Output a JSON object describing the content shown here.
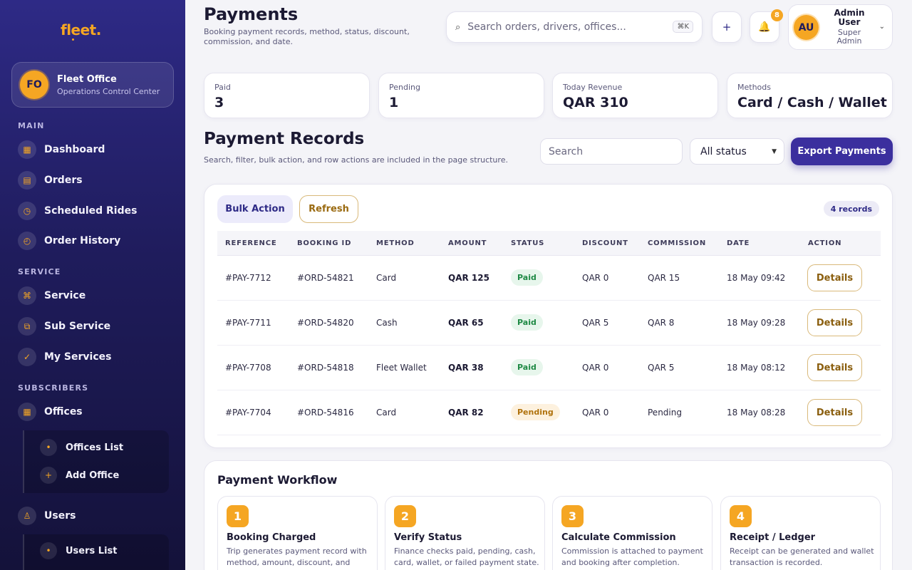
{
  "app": {
    "logo": "fleet."
  },
  "office": {
    "initials": "FO",
    "name": "Fleet Office",
    "subtitle": "Operations Control Center"
  },
  "sidebar": {
    "sections": [
      {
        "label": "MAIN"
      },
      {
        "label": "SERVICE"
      },
      {
        "label": "SUBSCRIBERS"
      }
    ],
    "items": [
      {
        "label": "Dashboard",
        "icon": "dashboard-icon",
        "glyph": "▦"
      },
      {
        "label": "Orders",
        "icon": "orders-icon",
        "glyph": "▤"
      },
      {
        "label": "Scheduled Rides",
        "icon": "clock-icon",
        "glyph": "◷"
      },
      {
        "label": "Order History",
        "icon": "history-icon",
        "glyph": "◴"
      },
      {
        "label": "Service",
        "icon": "command-icon",
        "glyph": "⌘"
      },
      {
        "label": "Sub Service",
        "icon": "copy-icon",
        "glyph": "⧉"
      },
      {
        "label": "My Services",
        "icon": "check-icon",
        "glyph": "✓"
      },
      {
        "label": "Offices",
        "icon": "offices-icon",
        "glyph": "▦"
      },
      {
        "label": "Users",
        "icon": "user-icon",
        "glyph": "♙"
      }
    ],
    "offices_sub": [
      {
        "label": "Offices List",
        "glyph": "•"
      },
      {
        "label": "Add Office",
        "glyph": "+"
      }
    ],
    "users_sub": [
      {
        "label": "Users List",
        "glyph": "•"
      }
    ]
  },
  "header": {
    "title": "Payments",
    "subtitle": "Booking payment records, method, status, discount, commission, and date.",
    "search_placeholder": "Search orders, drivers, offices...",
    "shortcut": "⌘K",
    "add_glyph": "+",
    "bell_glyph": "🔔",
    "notification_count": "8",
    "user": {
      "initials": "AU",
      "name": "Admin User",
      "role": "Super Admin"
    }
  },
  "stats": [
    {
      "label": "Paid",
      "value": "3"
    },
    {
      "label": "Pending",
      "value": "1"
    },
    {
      "label": "Today Revenue",
      "value": "QAR 310"
    },
    {
      "label": "Methods",
      "value": "Card / Cash / Wallet"
    }
  ],
  "records": {
    "title": "Payment Records",
    "subtitle": "Search, filter, bulk action, and row actions are included in the page structure.",
    "search_placeholder": "Search",
    "status_filter": "All status",
    "export_label": "Export Payments",
    "bulk_label": "Bulk Action",
    "refresh_label": "Refresh",
    "count_label": "4 records",
    "columns": [
      "REFERENCE",
      "BOOKING ID",
      "METHOD",
      "AMOUNT",
      "STATUS",
      "DISCOUNT",
      "COMMISSION",
      "DATE",
      "ACTION"
    ],
    "rows": [
      {
        "reference": "#PAY-7712",
        "booking": "#ORD-54821",
        "method": "Card",
        "amount": "QAR 125",
        "status": "Paid",
        "status_type": "paid",
        "discount": "QAR 0",
        "commission": "QAR 15",
        "date": "18 May 09:42",
        "action": "Details"
      },
      {
        "reference": "#PAY-7711",
        "booking": "#ORD-54820",
        "method": "Cash",
        "amount": "QAR 65",
        "status": "Paid",
        "status_type": "paid",
        "discount": "QAR 5",
        "commission": "QAR 8",
        "date": "18 May 09:28",
        "action": "Details"
      },
      {
        "reference": "#PAY-7708",
        "booking": "#ORD-54818",
        "method": "Fleet Wallet",
        "amount": "QAR 38",
        "status": "Paid",
        "status_type": "paid",
        "discount": "QAR 0",
        "commission": "QAR 5",
        "date": "18 May 08:12",
        "action": "Details"
      },
      {
        "reference": "#PAY-7704",
        "booking": "#ORD-54816",
        "method": "Card",
        "amount": "QAR 82",
        "status": "Pending",
        "status_type": "pending",
        "discount": "QAR 0",
        "commission": "Pending",
        "date": "18 May 08:28",
        "action": "Details"
      }
    ]
  },
  "workflow": {
    "title": "Payment Workflow",
    "steps": [
      {
        "num": "1",
        "title": "Booking Charged",
        "desc": "Trip generates payment record with method, amount, discount, and date."
      },
      {
        "num": "2",
        "title": "Verify Status",
        "desc": "Finance checks paid, pending, cash, card, wallet, or failed payment state."
      },
      {
        "num": "3",
        "title": "Calculate Commission",
        "desc": "Commission is attached to payment and booking after completion."
      },
      {
        "num": "4",
        "title": "Receipt / Ledger",
        "desc": "Receipt can be generated and wallet transaction is recorded."
      }
    ]
  },
  "colors": {
    "accent": "#f5a623",
    "brand": "#3b2f9e",
    "sidebar": "#1f1c5c",
    "paid": "#1f8a45",
    "pending": "#b0720d"
  }
}
